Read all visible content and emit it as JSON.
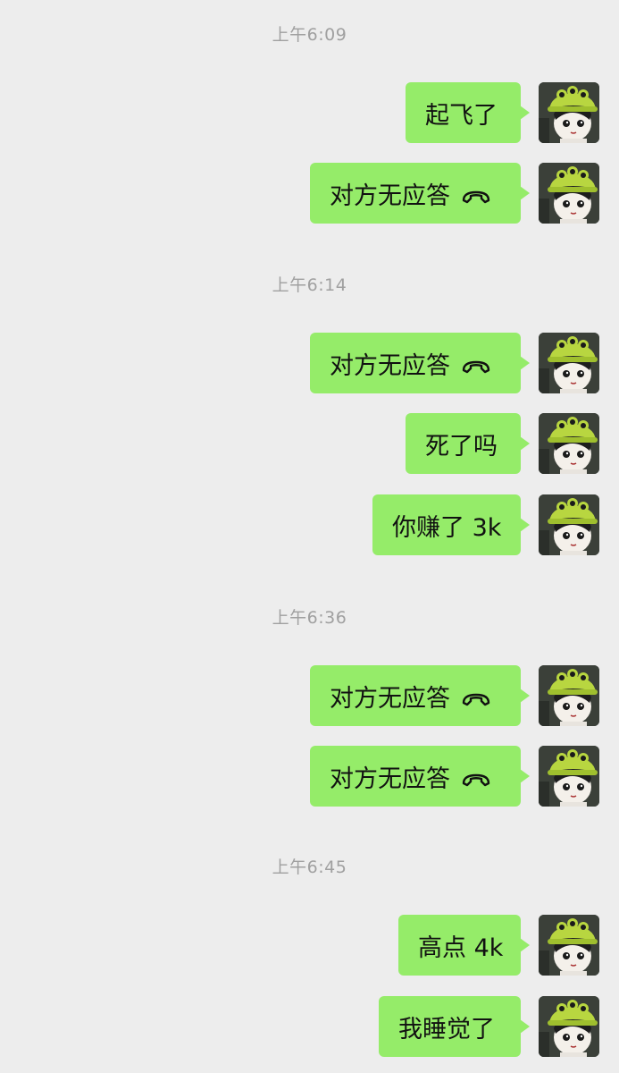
{
  "chat": {
    "timestamps": [
      "上午6:09",
      "上午6:14",
      "上午6:36",
      "上午6:45"
    ],
    "messages": [
      {
        "text": "起飞了",
        "icon": ""
      },
      {
        "text": "对方无应答",
        "icon": "phone-hangup-icon"
      },
      {
        "text": "对方无应答",
        "icon": "phone-hangup-icon"
      },
      {
        "text": "死了吗",
        "icon": ""
      },
      {
        "text": "你赚了 3k",
        "icon": ""
      },
      {
        "text": "对方无应答",
        "icon": "phone-hangup-icon"
      },
      {
        "text": "对方无应答",
        "icon": "phone-hangup-icon"
      },
      {
        "text": "高点 4k",
        "icon": ""
      },
      {
        "text": "我睡觉了",
        "icon": ""
      }
    ]
  },
  "colors": {
    "background": "#ededed",
    "bubble": "#95ec69",
    "timestamp": "#a0a0a0",
    "avatar_hat": "#b8d640"
  }
}
